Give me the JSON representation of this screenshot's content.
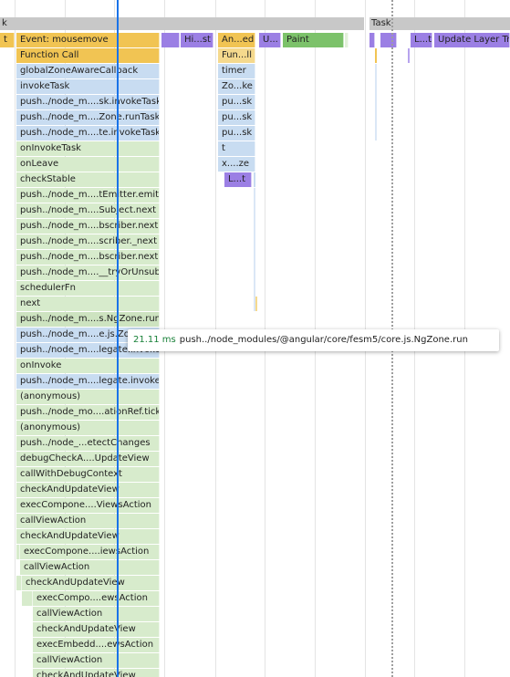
{
  "task_row": {
    "left_label": "k",
    "right_label": "Task"
  },
  "column1": [
    {
      "label": "Event: mousemove",
      "color": "yellow"
    },
    {
      "label": "Function Call",
      "color": "yellow"
    },
    {
      "label": "globalZoneAwareCallback",
      "color": "blue"
    },
    {
      "label": "invokeTask",
      "color": "blue"
    },
    {
      "label": "push../node_m....sk.invokeTask",
      "color": "blue"
    },
    {
      "label": "push../node_m....Zone.runTask",
      "color": "blue"
    },
    {
      "label": "push../node_m....te.invokeTask",
      "color": "blue"
    },
    {
      "label": "onInvokeTask",
      "color": "green"
    },
    {
      "label": "onLeave",
      "color": "green"
    },
    {
      "label": "checkStable",
      "color": "green"
    },
    {
      "label": "push../node_m....tEmitter.emit",
      "color": "green"
    },
    {
      "label": "push../node_m....Subject.next",
      "color": "green"
    },
    {
      "label": "push../node_m....bscriber.next",
      "color": "green"
    },
    {
      "label": "push../node_m....scriber._next",
      "color": "green"
    },
    {
      "label": "push../node_m....bscriber.next",
      "color": "green"
    },
    {
      "label": "push../node_m....__tryOrUnsub",
      "color": "green"
    },
    {
      "label": "schedulerFn",
      "color": "green"
    },
    {
      "label": "next",
      "color": "green"
    },
    {
      "label": "push../node_m....s.NgZone.run",
      "color": "greenmid"
    },
    {
      "label": "push../node_m....e.js.Zone.run",
      "color": "blue"
    },
    {
      "label": "push../node_m....legate.invoke",
      "color": "blue"
    },
    {
      "label": "onInvoke",
      "color": "green"
    },
    {
      "label": "push../node_m....legate.invoke",
      "color": "blue"
    },
    {
      "label": "(anonymous)",
      "color": "green"
    },
    {
      "label": "push../node_mo....ationRef.tick",
      "color": "green"
    },
    {
      "label": "(anonymous)",
      "color": "green"
    },
    {
      "label": "push../node_...etectChanges",
      "color": "green"
    },
    {
      "label": "debugCheckA....UpdateView",
      "color": "green"
    },
    {
      "label": "callWithDebugContext",
      "color": "green"
    },
    {
      "label": "checkAndUpdateView",
      "color": "green"
    },
    {
      "label": "execCompone....ViewsAction",
      "color": "green"
    },
    {
      "label": "callViewAction",
      "color": "green"
    },
    {
      "label": "checkAndUpdateView",
      "color": "green"
    },
    {
      "label": "execCompone....iewsAction",
      "color": "green"
    },
    {
      "label": "callViewAction",
      "color": "green"
    },
    {
      "label": "checkAndUpdateView",
      "color": "green"
    },
    {
      "label": "execCompo....ewsAction",
      "color": "green"
    },
    {
      "label": "callViewAction",
      "color": "green"
    },
    {
      "label": "checkAndUpdateView",
      "color": "green"
    },
    {
      "label": "execEmbedd....ewsAction",
      "color": "green"
    },
    {
      "label": "callViewAction",
      "color": "green"
    },
    {
      "label": "checkAndUpdateView",
      "color": "green"
    }
  ],
  "top_row": [
    {
      "label": "t",
      "color": "yellow"
    },
    {
      "label": "",
      "color": "purple"
    },
    {
      "label": "Hi...st",
      "color": "purple"
    },
    {
      "label": "An...ed",
      "color": "yellow"
    },
    {
      "label": "U...",
      "color": "purple"
    },
    {
      "label": "Paint",
      "color": "greenpaint"
    },
    {
      "label": "L...t",
      "color": "purple"
    },
    {
      "label": "Update Layer Tre",
      "color": "purple"
    }
  ],
  "column2": [
    {
      "label": "Fun...ll",
      "color": "yellow"
    },
    {
      "label": "timer",
      "color": "blue"
    },
    {
      "label": "Zo...ke",
      "color": "blue"
    },
    {
      "label": "pu...sk",
      "color": "blue"
    },
    {
      "label": "pu...sk",
      "color": "blue"
    },
    {
      "label": "pu...sk",
      "color": "blue"
    },
    {
      "label": "t",
      "color": "blue"
    },
    {
      "label": "x....ze",
      "color": "blue"
    },
    {
      "label": "L...t",
      "color": "purple"
    }
  ],
  "tooltip": {
    "duration": "21.11 ms",
    "name": "push../node_modules/@angular/core/fesm5/core.js.NgZone.run"
  },
  "colors": {
    "yellow": "#f1c453",
    "blue": "#c8dcf1",
    "green": "#d7ebcc",
    "purple": "#9b7fe4",
    "paint": "#7cc26a",
    "cursor": "#1a73e8"
  }
}
